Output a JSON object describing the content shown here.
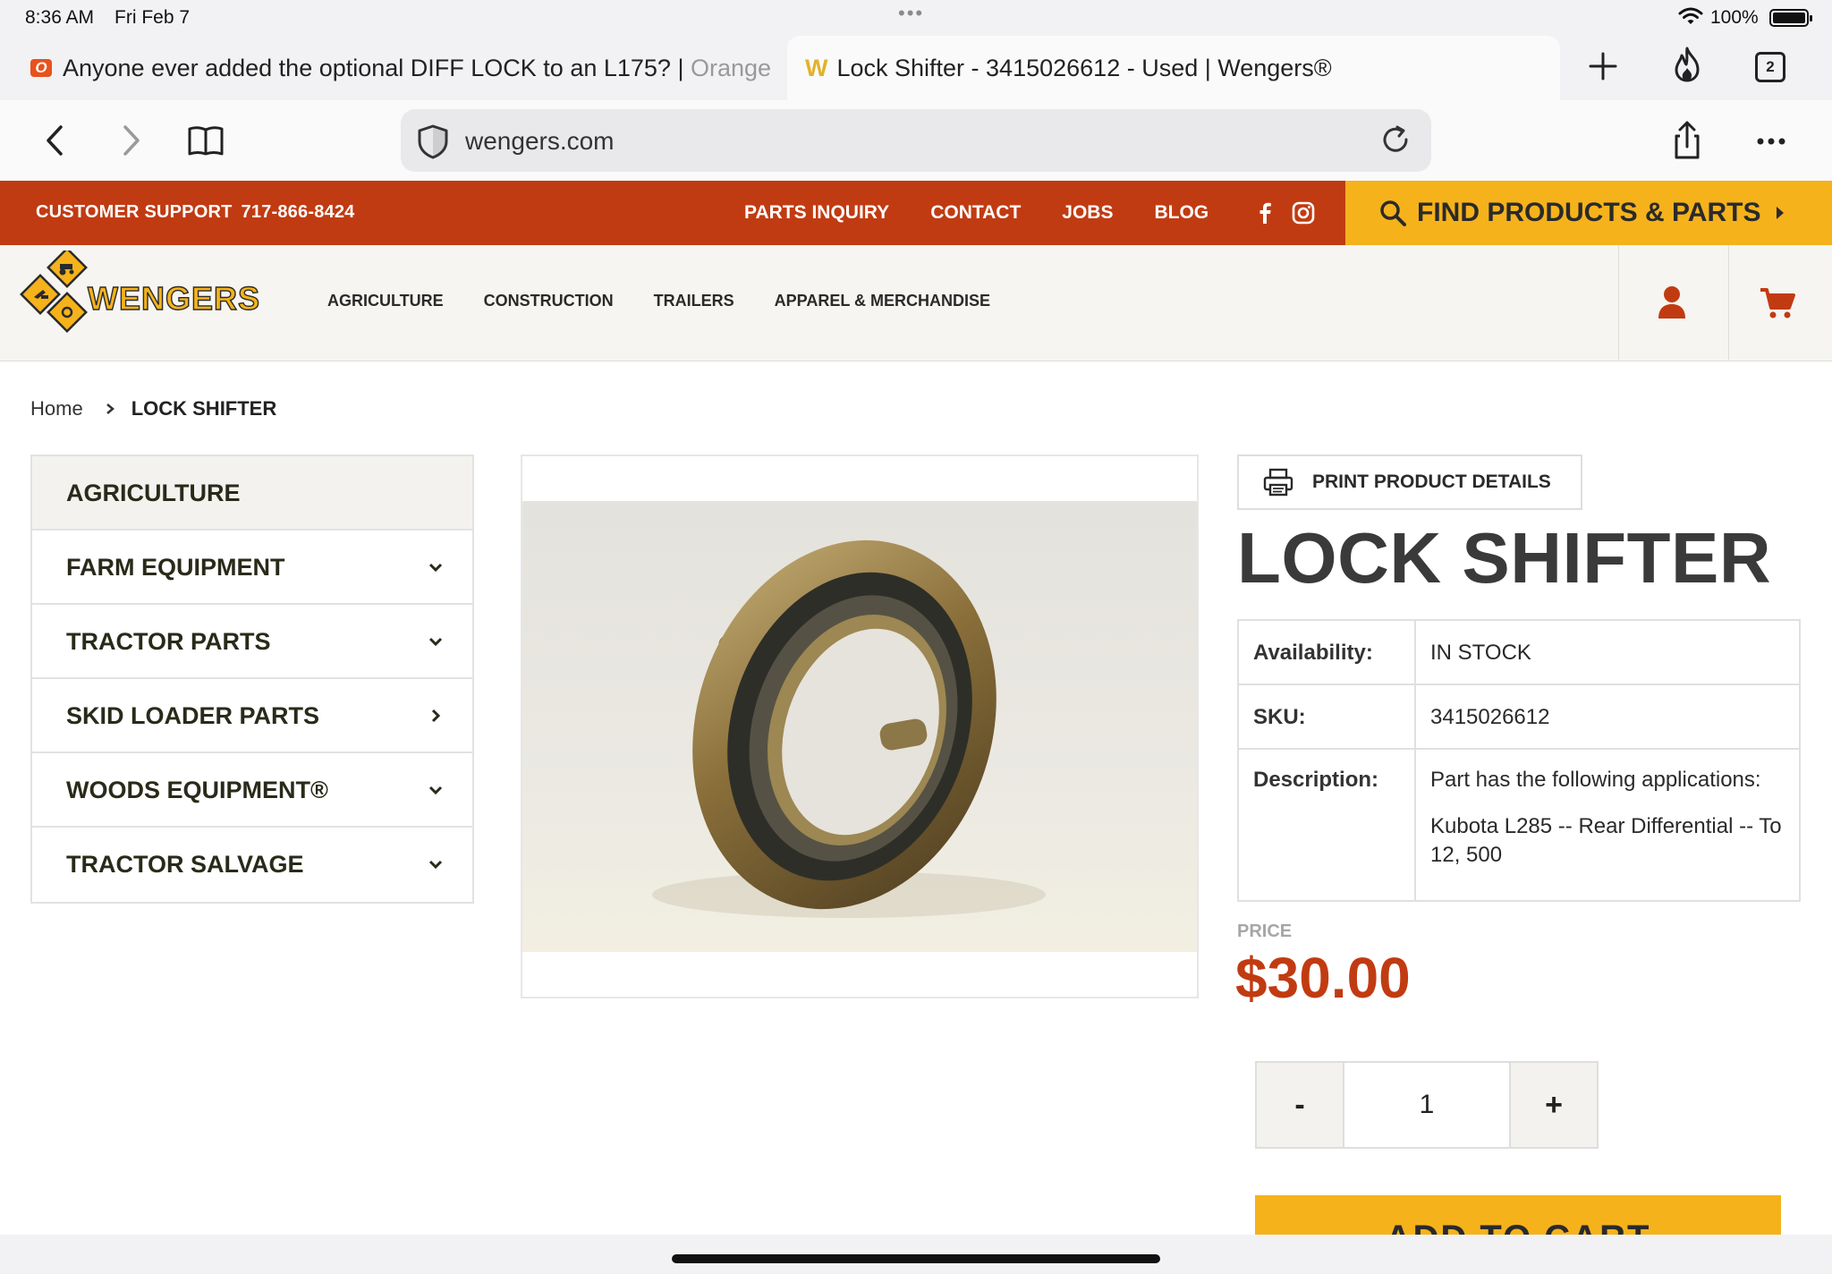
{
  "status_bar": {
    "time": "8:36 AM",
    "date": "Fri Feb 7",
    "battery_pct": "100%",
    "battery_level": 1.0
  },
  "tabs": [
    {
      "title_main": "Anyone ever added the optional DIFF LOCK to an L175? | ",
      "title_dim": "Orange"
    },
    {
      "title": "Lock Shifter - 3415026612 - Used | Wengers®",
      "active": true
    }
  ],
  "tab_count": "2",
  "address_bar": {
    "url": "wengers.com"
  },
  "support": {
    "label": "CUSTOMER SUPPORT",
    "phone": "717-866-8424"
  },
  "top_links": [
    "PARTS INQUIRY",
    "CONTACT",
    "JOBS",
    "BLOG"
  ],
  "find_button": {
    "label": "FIND PRODUCTS & PARTS"
  },
  "logo": {
    "text": "WENGERS"
  },
  "main_nav": [
    "AGRICULTURE",
    "CONSTRUCTION",
    "TRAILERS",
    "APPAREL & MERCHANDISE"
  ],
  "breadcrumb": {
    "home": "Home",
    "current": "LOCK SHIFTER"
  },
  "sidebar": {
    "heading": "AGRICULTURE",
    "items": [
      {
        "label": "FARM EQUIPMENT",
        "chevron": "down"
      },
      {
        "label": "TRACTOR PARTS",
        "chevron": "down"
      },
      {
        "label": "SKID LOADER PARTS",
        "chevron": "right"
      },
      {
        "label": "WOODS EQUIPMENT®",
        "chevron": "down"
      },
      {
        "label": "TRACTOR SALVAGE",
        "chevron": "down"
      }
    ]
  },
  "product": {
    "print_label": "PRINT PRODUCT DETAILS",
    "title": "LOCK SHIFTER",
    "availability_label": "Availability:",
    "availability": "IN STOCK",
    "sku_label": "SKU:",
    "sku": "3415026612",
    "description_label": "Description:",
    "description_line1": "Part has the following applications:",
    "description_line2": "Kubota L285 -- Rear Differential -- To 12, 500",
    "price_label": "PRICE",
    "price": "$30.00",
    "quantity": "1",
    "qty_minus": "-",
    "qty_plus": "+",
    "add_to_cart": "ADD TO CART"
  },
  "colors": {
    "brand_orange": "#c13b12",
    "brand_yellow": "#f5b21b",
    "header_bg": "#f6f5f1"
  }
}
